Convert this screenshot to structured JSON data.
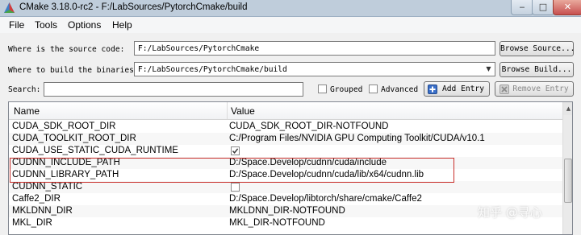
{
  "window": {
    "title": "CMake 3.18.0-rc2 - F:/LabSources/PytorchCmake/build"
  },
  "menu": [
    "File",
    "Tools",
    "Options",
    "Help"
  ],
  "source": {
    "label": "Where is the source code:",
    "value": "F:/LabSources/PytorchCmake",
    "button": "Browse Source..."
  },
  "build": {
    "label": "Where to build the binaries:",
    "value": "F:/LabSources/PytorchCmake/build",
    "button": "Browse Build..."
  },
  "search": {
    "label": "Search:",
    "value": ""
  },
  "options": {
    "grouped_label": "Grouped",
    "advanced_label": "Advanced"
  },
  "actions": {
    "add_entry": "Add Entry",
    "remove_entry": "Remove Entry"
  },
  "table": {
    "headers": {
      "name": "Name",
      "value": "Value"
    },
    "rows": [
      {
        "name": "CUDA_SDK_ROOT_DIR",
        "value": "CUDA_SDK_ROOT_DIR-NOTFOUND"
      },
      {
        "name": "CUDA_TOOLKIT_ROOT_DIR",
        "value": "C:/Program Files/NVIDIA GPU Computing Toolkit/CUDA/v10.1"
      },
      {
        "name": "CUDA_USE_STATIC_CUDA_RUNTIME",
        "value": "",
        "checkbox": true,
        "checked": true
      },
      {
        "name": "CUDNN_INCLUDE_PATH",
        "value": "D:/Space.Develop/cudnn/cuda/include"
      },
      {
        "name": "CUDNN_LIBRARY_PATH",
        "value": "D:/Space.Develop/cudnn/cuda/lib/x64/cudnn.lib"
      },
      {
        "name": "CUDNN_STATIC",
        "value": "",
        "checkbox": true,
        "checked": false
      },
      {
        "name": "Caffe2_DIR",
        "value": "D:/Space.Develop/libtorch/share/cmake/Caffe2"
      },
      {
        "name": "MKLDNN_DIR",
        "value": "MKLDNN_DIR-NOTFOUND"
      },
      {
        "name": "MKL_DIR",
        "value": "MKL_DIR-NOTFOUND"
      }
    ]
  },
  "watermark": "知乎 @寻心",
  "colors": {
    "highlight_border": "#c9302c",
    "titlebar": "#bfcddb"
  }
}
